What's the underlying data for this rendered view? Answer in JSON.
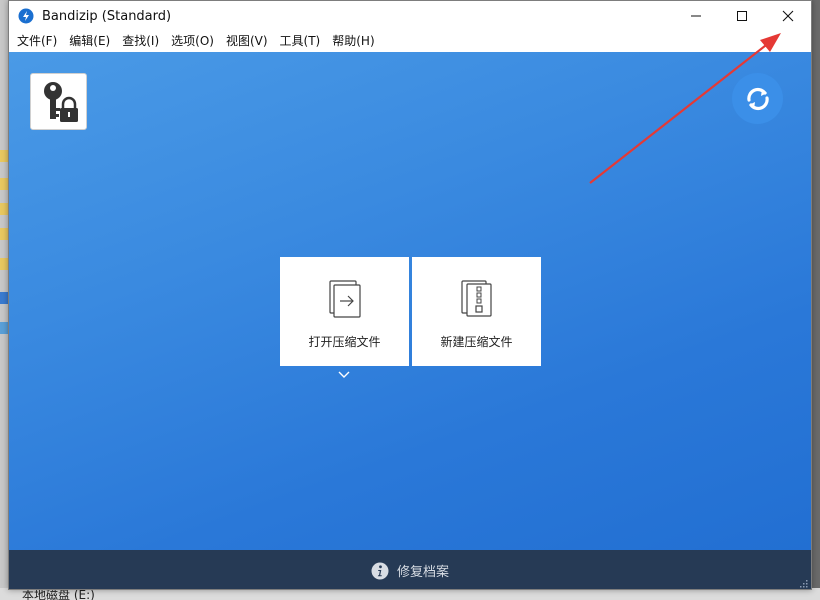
{
  "window": {
    "title": "Bandizip (Standard)",
    "app_icon": "bandizip-icon",
    "controls": [
      "minimize-icon",
      "maximize-icon",
      "close-icon"
    ]
  },
  "menu": {
    "items": [
      {
        "label": "文件(F)"
      },
      {
        "label": "编辑(E)"
      },
      {
        "label": "查找(I)"
      },
      {
        "label": "选项(O)"
      },
      {
        "label": "视图(V)"
      },
      {
        "label": "工具(T)"
      },
      {
        "label": "帮助(H)"
      }
    ]
  },
  "main": {
    "key_button_icon": "key-lock-icon",
    "refresh_icon": "refresh-icon",
    "tiles": [
      {
        "label": "打开压缩文件",
        "icon": "open-archive-icon"
      },
      {
        "label": "新建压缩文件",
        "icon": "new-archive-icon"
      }
    ],
    "expand_icon": "chevron-down-icon"
  },
  "footer": {
    "repair_label": "修复档案",
    "icon": "info-icon"
  },
  "desktop": {
    "taskbar_text": "本地磁盘 (E:)"
  },
  "colors": {
    "main_bg": "#3a8ae0",
    "footer_bg": "#263a55",
    "annotation_arrow": "#e53935"
  }
}
